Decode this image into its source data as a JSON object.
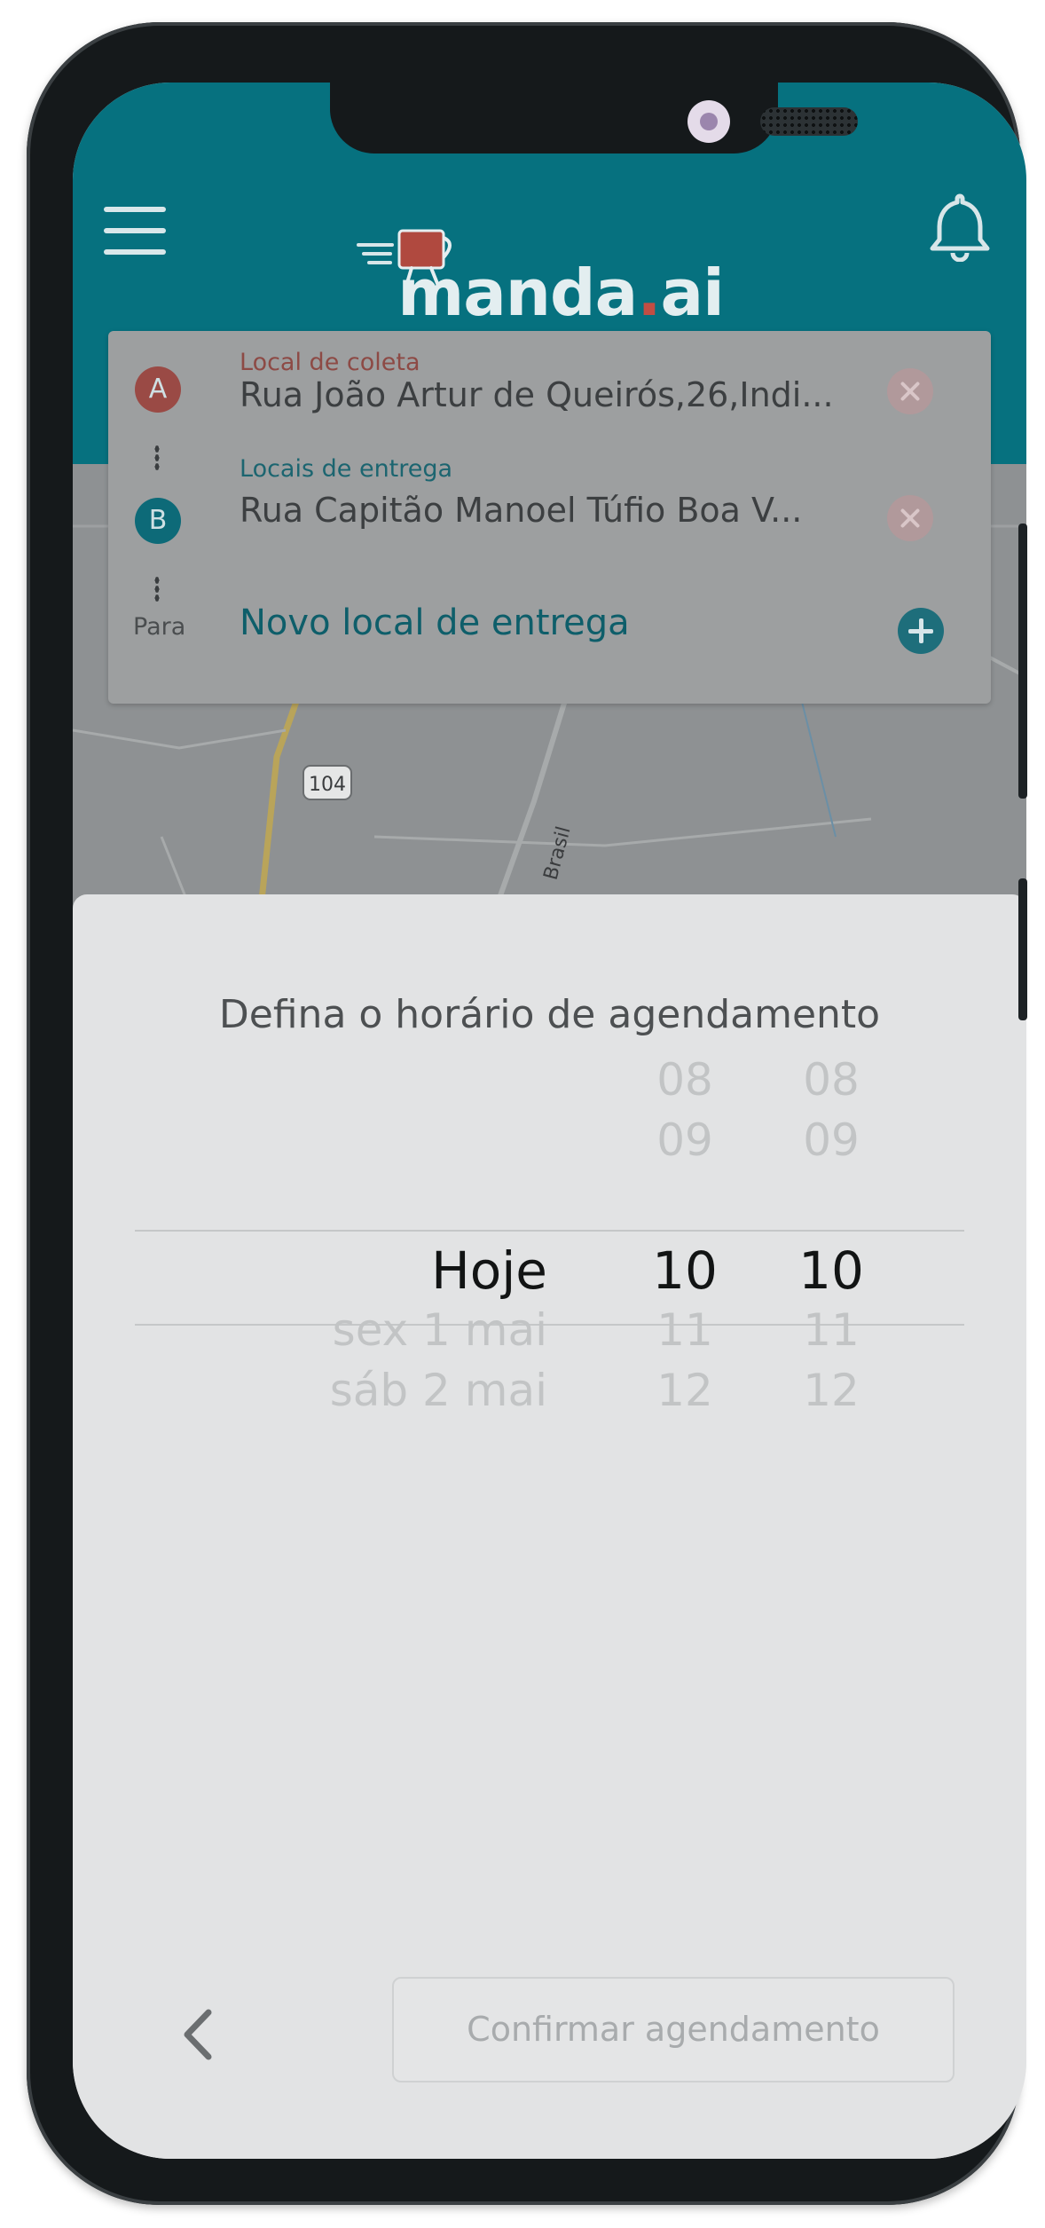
{
  "app": {
    "logo_text": "manda",
    "logo_dot": ".",
    "logo_suffix": "ai"
  },
  "route": {
    "pickup_label": "Local de coleta",
    "pickup_marker": "A",
    "pickup_address": "Rua João Artur de Queirós,26,Indi...",
    "delivery_label": "Locais de entrega",
    "delivery_marker": "B",
    "delivery_address": "Rua Capitão Manoel Túfio Boa V...",
    "para_label": "Para",
    "new_location": "Novo local de entrega"
  },
  "map": {
    "road_label": "104",
    "street_label": "Brasil"
  },
  "schedule": {
    "title": "Defina o horário de agendamento",
    "days": [
      "Hoje",
      "sex 1 mai",
      "sáb 2 mai"
    ],
    "hours": [
      "08",
      "09",
      "10",
      "11",
      "12"
    ],
    "minutes": [
      "08",
      "09",
      "10",
      "11",
      "12"
    ],
    "selected_day": "Hoje",
    "selected_hour": "10",
    "selected_minute": "10",
    "confirm_label": "Confirmar agendamento"
  },
  "colors": {
    "header": "#06717f",
    "pickup": "#9a4a45",
    "delivery": "#0d6a78"
  },
  "icons": {
    "menu": "hamburger-menu-icon",
    "notifications": "bell-icon",
    "back": "chevron-left-icon",
    "remove": "close-circle-icon",
    "add": "plus-circle-icon"
  }
}
